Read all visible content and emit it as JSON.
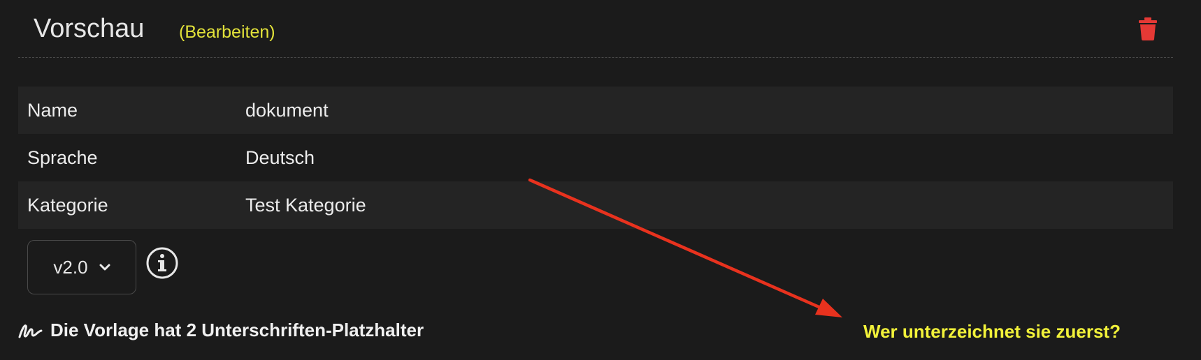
{
  "header": {
    "title": "Vorschau",
    "edit_label": "(Bearbeiten)"
  },
  "details": [
    {
      "label": "Name",
      "value": "dokument"
    },
    {
      "label": "Sprache",
      "value": "Deutsch"
    },
    {
      "label": "Kategorie",
      "value": "Test Kategorie"
    }
  ],
  "version": {
    "selected": "v2.0"
  },
  "signature": {
    "text": "Die Vorlage hat 2 Unterschriften-Platzhalter"
  },
  "annotation": {
    "text": "Wer unterzeichnet sie zuerst?"
  },
  "colors": {
    "accent_yellow": "#e2e23a",
    "delete_red": "#e53935",
    "arrow_red": "#e8321e",
    "background": "#1b1b1b"
  },
  "icons": {
    "delete": "trash-icon",
    "info": "info-icon",
    "version_toggle": "chevron-down-icon",
    "signature": "signature-icon"
  }
}
